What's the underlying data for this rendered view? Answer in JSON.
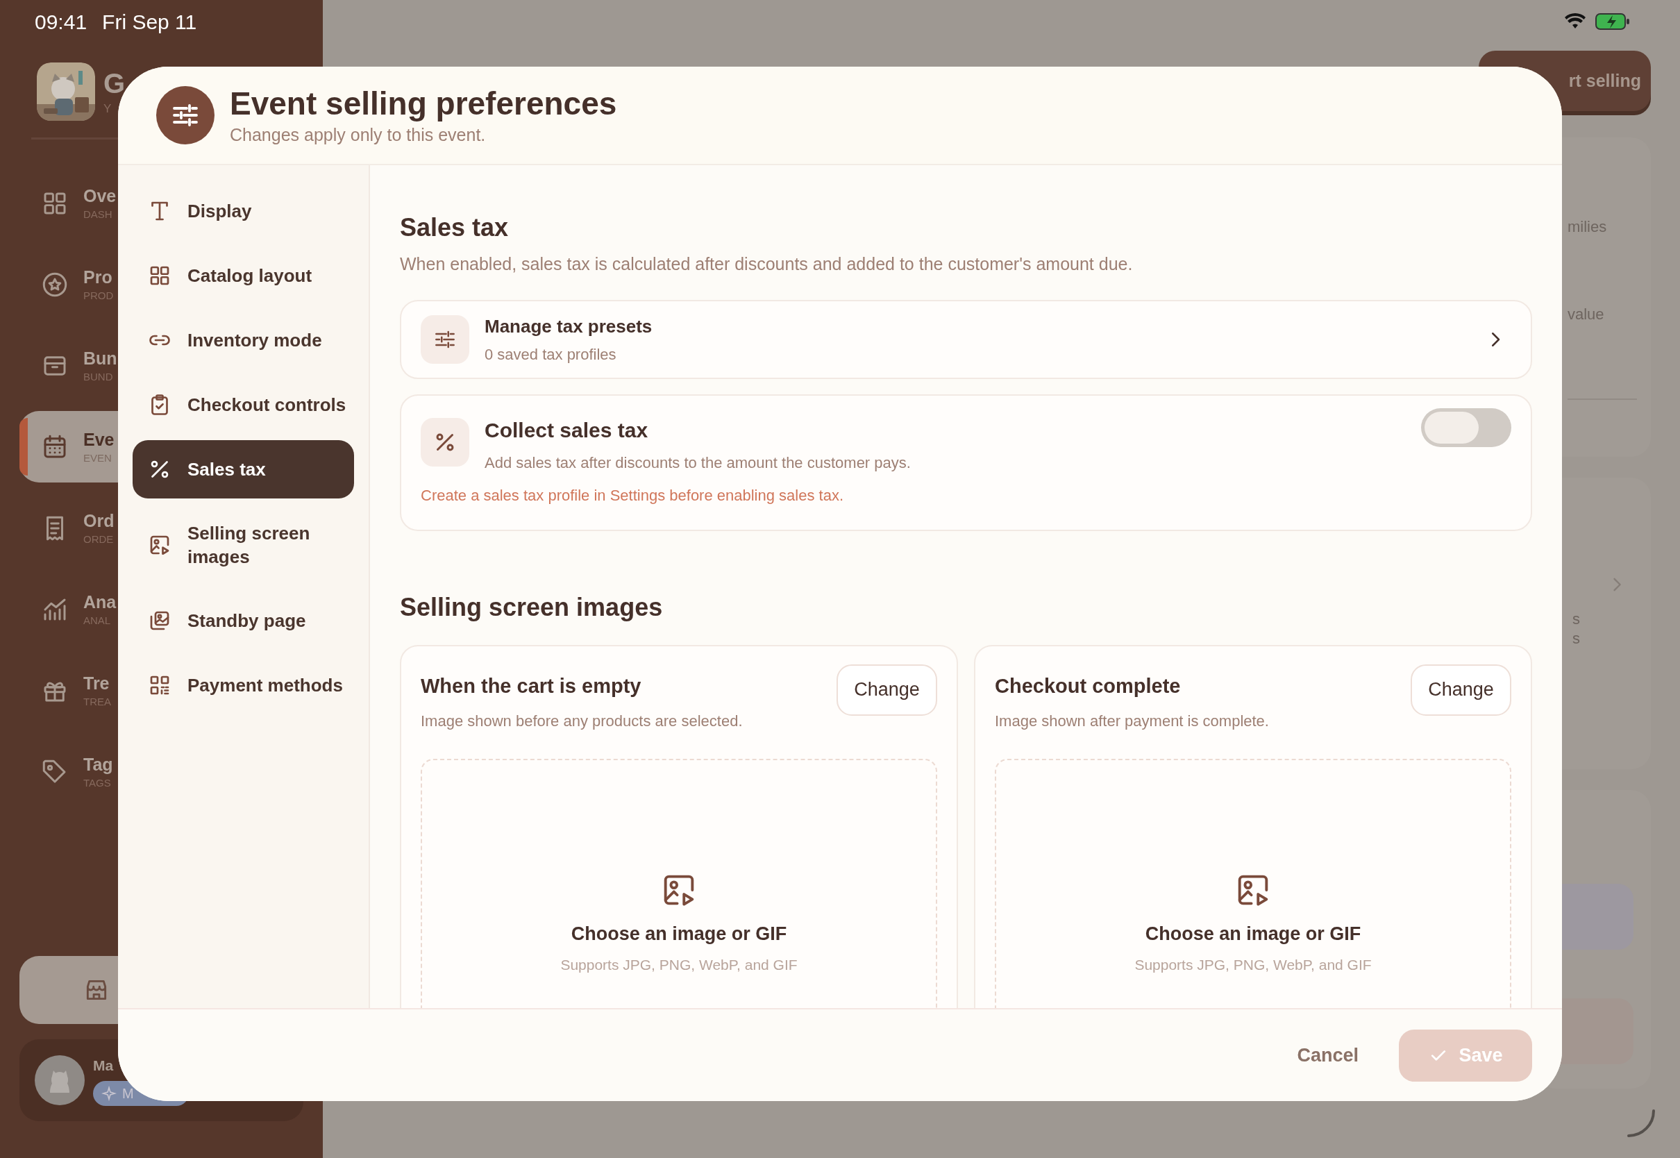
{
  "status_bar": {
    "time": "09:41",
    "date": "Fri Sep 11"
  },
  "app_sidebar": {
    "app_name": "G",
    "app_subtitle": "Y",
    "items": [
      {
        "label": "Ove",
        "sub": "DASH",
        "selected": false
      },
      {
        "label": "Pro",
        "sub": "PROD",
        "selected": false
      },
      {
        "label": "Bun",
        "sub": "BUND",
        "selected": false
      },
      {
        "label": "Eve",
        "sub": "EVEN",
        "selected": true
      },
      {
        "label": "Ord",
        "sub": "ORDE",
        "selected": false
      },
      {
        "label": "Ana",
        "sub": "ANAL",
        "selected": false
      },
      {
        "label": "Tre",
        "sub": "TREA",
        "selected": false
      },
      {
        "label": "Tag",
        "sub": "TAGS",
        "selected": false
      }
    ],
    "user": {
      "name": "Ma",
      "badge": "M"
    }
  },
  "main": {
    "start_button": "rt selling",
    "card_texts": [
      "milies",
      "value"
    ],
    "card2_texts": [
      "s",
      "s"
    ]
  },
  "dialog": {
    "title": "Event selling preferences",
    "subtitle": "Changes apply only to this event.",
    "nav": [
      {
        "label": "Display",
        "selected": false
      },
      {
        "label": "Catalog layout",
        "selected": false
      },
      {
        "label": "Inventory mode",
        "selected": false
      },
      {
        "label": "Checkout controls",
        "selected": false
      },
      {
        "label": "Sales tax",
        "selected": true
      },
      {
        "label": "Selling screen images",
        "selected": false
      },
      {
        "label": "Standby page",
        "selected": false
      },
      {
        "label": "Payment methods",
        "selected": false
      }
    ],
    "tax": {
      "title": "Sales tax",
      "description": "When enabled, sales tax is calculated after discounts and added to the customer's amount due.",
      "presets": {
        "title": "Manage tax presets",
        "subtitle": "0 saved tax profiles"
      },
      "collect": {
        "title": "Collect sales tax",
        "subtitle": "Add sales tax after discounts to the amount the customer pays.",
        "on": false,
        "warning": "Create a sales tax profile in Settings before enabling sales tax."
      }
    },
    "images": {
      "title": "Selling screen images",
      "cards": [
        {
          "title": "When the cart is empty",
          "subtitle": "Image shown before any products are selected.",
          "button": "Change",
          "prompt": "Choose an image or GIF",
          "formats": "Supports JPG, PNG, WebP, and GIF"
        },
        {
          "title": "Checkout complete",
          "subtitle": "Image shown after payment is complete.",
          "button": "Change",
          "prompt": "Choose an image or GIF",
          "formats": "Supports JPG, PNG, WebP, and GIF"
        }
      ]
    },
    "cancel": "Cancel",
    "save": {
      "label": "Save",
      "disabled": true
    }
  }
}
